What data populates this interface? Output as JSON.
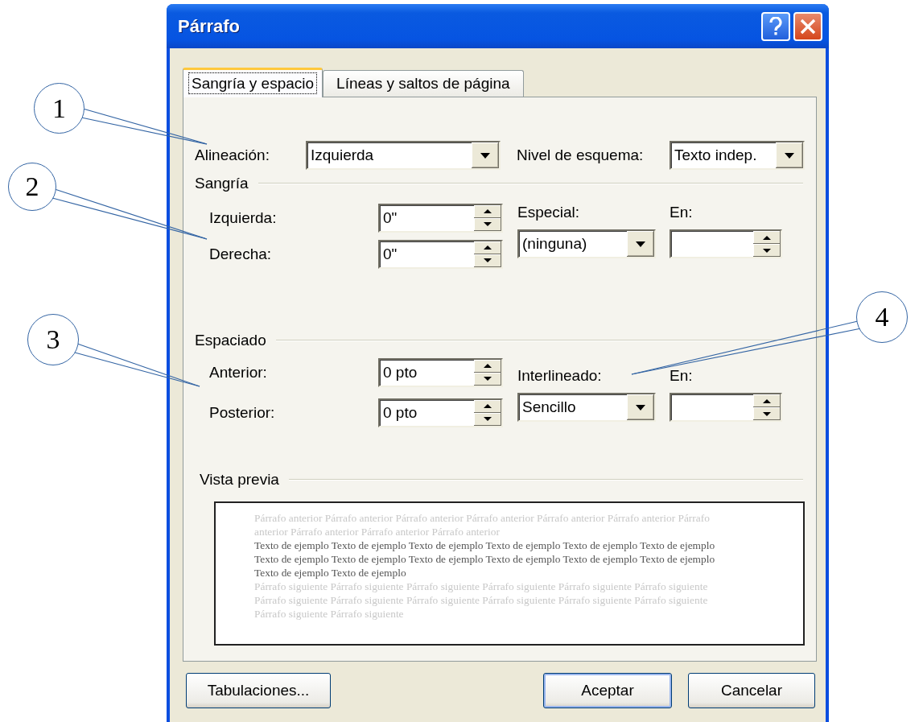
{
  "window": {
    "title": "Párrafo"
  },
  "tabs": [
    {
      "label": "Sangría y espacio",
      "selected": true
    },
    {
      "label": "Líneas y saltos de página",
      "selected": false
    }
  ],
  "general": {
    "alignment": {
      "label": "Alineación:",
      "value": "Izquierda"
    },
    "outline_level": {
      "label": "Nivel de esquema:",
      "value": "Texto indep."
    }
  },
  "indentation": {
    "title": "Sangría",
    "left": {
      "label": "Izquierda:",
      "value": "0\""
    },
    "right": {
      "label": "Derecha:",
      "value": "0\""
    },
    "special": {
      "label": "Especial:",
      "value": "(ninguna)"
    },
    "by": {
      "label": "En:"
    }
  },
  "spacing": {
    "title": "Espaciado",
    "before": {
      "label": "Anterior:",
      "value": "0 pto"
    },
    "after": {
      "label": "Posterior:",
      "value": "0 pto"
    },
    "line_spacing": {
      "label": "Interlineado:",
      "value": "Sencillo"
    },
    "at": {
      "label": "En:"
    }
  },
  "preview": {
    "title": "Vista previa",
    "previous": "Párrafo anterior Párrafo anterior Párrafo anterior Párrafo anterior Párrafo anterior Párrafo anterior Párrafo anterior Párrafo anterior Párrafo anterior Párrafo anterior",
    "sample": "Texto de ejemplo Texto de ejemplo Texto de ejemplo Texto de ejemplo Texto de ejemplo Texto de ejemplo Texto de ejemplo Texto de ejemplo Texto de ejemplo Texto de ejemplo Texto de ejemplo Texto de ejemplo Texto de ejemplo Texto de ejemplo",
    "next": "Párrafo siguiente Párrafo siguiente Párrafo siguiente Párrafo siguiente Párrafo siguiente Párrafo siguiente Párrafo siguiente Párrafo siguiente Párrafo siguiente Párrafo siguiente Párrafo siguiente Párrafo siguiente Párrafo siguiente Párrafo siguiente"
  },
  "buttons": [
    {
      "label": "Tabulaciones...",
      "default": false
    },
    {
      "label": "Aceptar",
      "default": true
    },
    {
      "label": "Cancelar",
      "default": false
    }
  ],
  "callouts": [
    {
      "label": "1"
    },
    {
      "label": "2"
    },
    {
      "label": "3"
    },
    {
      "label": "4"
    }
  ]
}
